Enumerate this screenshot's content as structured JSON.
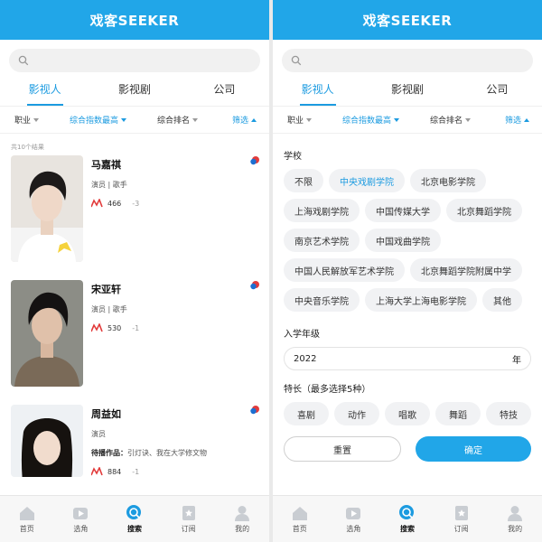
{
  "app": {
    "logo": "戏客SEEKER"
  },
  "search": {
    "placeholder": ""
  },
  "tabs": [
    {
      "label": "影视人"
    },
    {
      "label": "影视剧"
    },
    {
      "label": "公司"
    }
  ],
  "filters": {
    "occupation": "职业",
    "sort_index": "综合指数最高",
    "rank": "综合排名",
    "screen": "筛选"
  },
  "results": {
    "count_text": "共10个结果",
    "people": [
      {
        "name": "马嘉祺",
        "roles": "演员 | 歌手",
        "score": "466",
        "delta": "-3"
      },
      {
        "name": "宋亚轩",
        "roles": "演员 | 歌手",
        "score": "530",
        "delta": "-1"
      },
      {
        "name": "周益如",
        "roles": "演员",
        "works_label": "待播作品：",
        "works": "引灯诀、我在大学修文物",
        "score": "884",
        "delta": "-1"
      }
    ]
  },
  "panel": {
    "school_title": "学校",
    "schools": [
      "不限",
      "中央戏剧学院",
      "北京电影学院",
      "上海戏剧学院",
      "中国传媒大学",
      "北京舞蹈学院",
      "南京艺术学院",
      "中国戏曲学院",
      "中国人民解放军艺术学院",
      "北京舞蹈学院附属中学",
      "中央音乐学院",
      "上海大学上海电影学院",
      "其他"
    ],
    "selected_school": "中央戏剧学院",
    "grade_title": "入学年级",
    "grade_value": "2022",
    "grade_unit": "年",
    "skills_title": "特长（最多选择5种）",
    "skills": [
      "喜剧",
      "动作",
      "唱歌",
      "舞蹈",
      "特技"
    ],
    "reset_label": "重置",
    "confirm_label": "确定"
  },
  "nav": [
    {
      "label": "首页"
    },
    {
      "label": "选角"
    },
    {
      "label": "搜索"
    },
    {
      "label": "订阅"
    },
    {
      "label": "我的"
    }
  ],
  "colors": {
    "brand": "#21a6e8",
    "accent": "#1c9be0",
    "trend": "#e23b3b"
  },
  "icons": [
    "search-icon",
    "trend-icon",
    "badge-icon",
    "home-icon",
    "casting-icon",
    "search-nav-icon",
    "subscribe-icon",
    "profile-icon"
  ]
}
